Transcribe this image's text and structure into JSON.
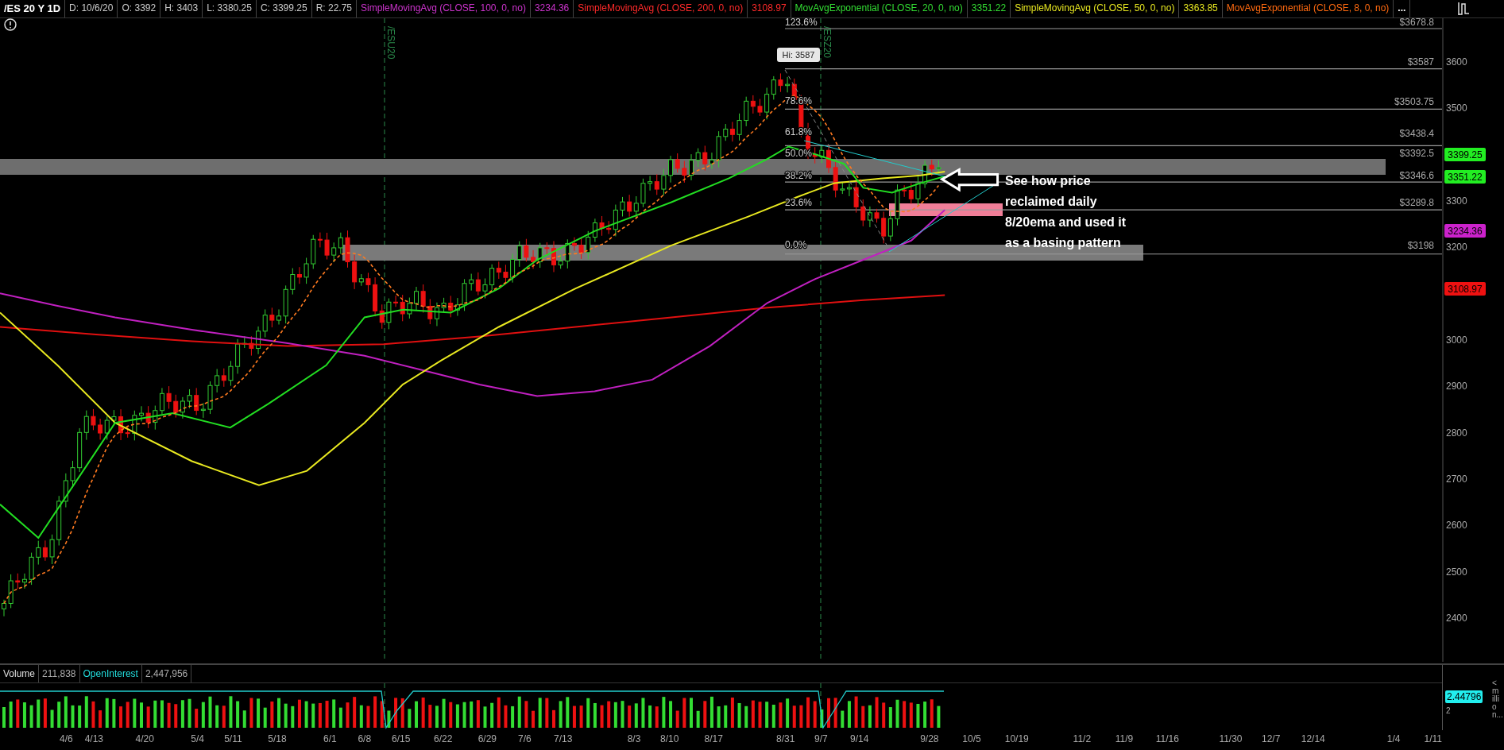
{
  "header": {
    "symbol": "/ES 20 Y 1D",
    "quote": [
      "D: 10/6/20",
      "O: 3392",
      "H: 3403",
      "L: 3380.25",
      "C: 3399.25",
      "R: 22.75"
    ],
    "studies": [
      {
        "label": "SimpleMovingAvg (CLOSE, 100, 0, no)",
        "value": "3234.36",
        "color": "#cc33cc"
      },
      {
        "label": "SimpleMovingAvg (CLOSE, 200, 0, no)",
        "value": "3108.97",
        "color": "#ff2a2a"
      },
      {
        "label": "MovAvgExponential (CLOSE, 20, 0, no)",
        "value": "3351.22",
        "color": "#33dd33"
      },
      {
        "label": "SimpleMovingAvg (CLOSE, 50, 0, no)",
        "value": "3363.85",
        "color": "#e6e620"
      },
      {
        "label": "MovAvgExponential (CLOSE, 8, 0, no)",
        "color": "#ff6a10"
      }
    ],
    "more": "..."
  },
  "price_chart": {
    "contracts": [
      "/ESU20",
      "/ESZ20"
    ],
    "high_label": "Hi: 3587",
    "fib_labels": [
      "123.6%",
      "78.6%",
      "61.8%",
      "50.0%",
      "38.2%",
      "23.6%",
      "0.0%"
    ],
    "levels": [
      "$3678.8",
      "$3587",
      "$3503.75",
      "$3438.4",
      "$3392.5",
      "$3346.6",
      "$3289.8",
      "$3198"
    ],
    "annotation": [
      "See how price",
      "reclaimed daily",
      "8/20ema and used it",
      "as a basing pattern"
    ],
    "price_axis": [
      "3600",
      "3500",
      "3300",
      "3200",
      "3000",
      "2900",
      "2800",
      "2700",
      "2600",
      "2500",
      "2400"
    ],
    "badges": [
      {
        "value": "3399.25",
        "color": "#22ee22"
      },
      {
        "value": "3351.22",
        "color": "#22ee22"
      },
      {
        "value": "3234.36",
        "color": "#cc22cc"
      },
      {
        "value": "3108.97",
        "color": "#ee1111"
      }
    ]
  },
  "volume": {
    "label": "Volume",
    "value": "211,838",
    "oi_label": "OpenInterest",
    "oi_value": "2,447,956",
    "badge": "2.44796",
    "unit": "<million...",
    "tick": "2"
  },
  "date_axis": [
    "4/6",
    "4/13",
    "4/20",
    "5/4",
    "5/11",
    "5/18",
    "6/1",
    "6/8",
    "6/15",
    "6/22",
    "6/29",
    "7/6",
    "7/13",
    "8/3",
    "8/10",
    "8/17",
    "8/31",
    "9/7",
    "9/14",
    "9/28",
    "10/5",
    "10/19",
    "11/2",
    "11/9",
    "11/16",
    "11/30",
    "12/7",
    "12/14",
    "1/4",
    "1/11"
  ]
}
